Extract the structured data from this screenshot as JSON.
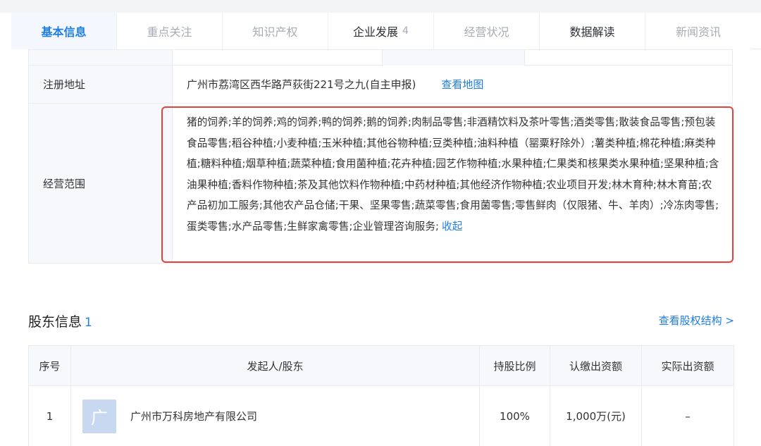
{
  "tabs": [
    {
      "label": "基本信息",
      "count": ""
    },
    {
      "label": "重点关注",
      "count": ""
    },
    {
      "label": "知识产权",
      "count": ""
    },
    {
      "label": "企业发展",
      "count": "4"
    },
    {
      "label": "经营状况",
      "count": ""
    },
    {
      "label": "数据解读",
      "count": ""
    },
    {
      "label": "新闻资讯",
      "count": ""
    }
  ],
  "info": {
    "address_label": "注册地址",
    "address_value": "广州市荔湾区西华路芦荻街221号之九(自主申报)",
    "map_link": "查看地图",
    "scope_label": "经营范围",
    "scope_value": "猪的饲养;羊的饲养;鸡的饲养;鸭的饲养;鹅的饲养;肉制品零售;非酒精饮料及茶叶零售;酒类零售;散装食品零售;预包装食品零售;稻谷种植;小麦种植;玉米种植;其他谷物种植;豆类种植;油料种植（罂粟籽除外）;薯类种植;棉花种植;麻类种植;糖料种植;烟草种植;蔬菜种植;食用菌种植;花卉种植;园艺作物种植;水果种植;仁果类和核果类水果种植;坚果种植;含油果种植;香料作物种植;茶及其他饮料作物种植;中药材种植;其他经济作物种植;农业项目开发;林木育种;林木育苗;农产品初加工服务;其他农产品仓储;干果、坚果零售;蔬菜零售;食用菌零售;零售鲜肉（仅限猪、牛、羊肉）;冷冻肉零售;蛋类零售;水产品零售;生鲜家禽零售;企业管理咨询服务;",
    "collapse_link": "收起"
  },
  "shareholders": {
    "title": "股东信息",
    "count": "1",
    "structure_link": "查看股权结构 >",
    "headers": [
      "序号",
      "发起人/股东",
      "持股比例",
      "认缴出资额",
      "实际出资额"
    ],
    "rows": [
      {
        "index": "1",
        "avatar": "广",
        "name": "广州市万科房地产有限公司",
        "ratio": "100%",
        "subscribed": "1,000万(元)",
        "paid": "–"
      }
    ]
  },
  "colors": {
    "accent": "#1d7ee6",
    "highlight": "#e8403a"
  }
}
